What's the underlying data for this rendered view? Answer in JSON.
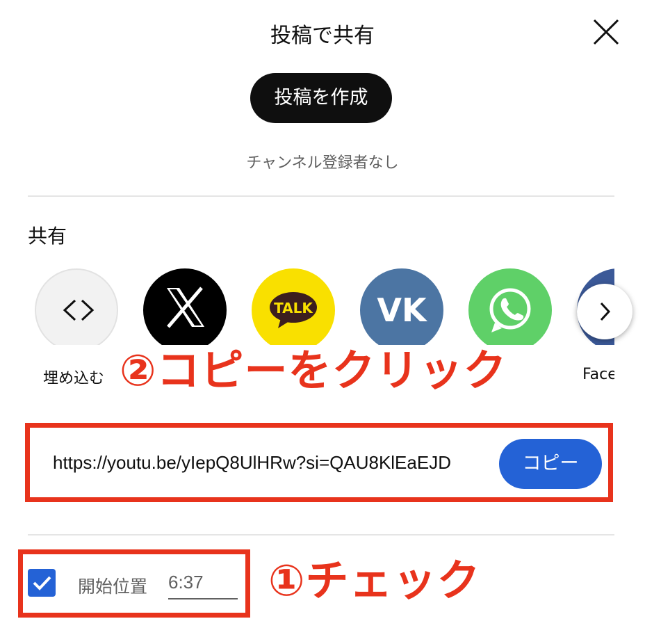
{
  "header": {
    "title": "投稿で共有",
    "close_icon": "close-icon"
  },
  "create_post": {
    "label": "投稿を作成"
  },
  "subscribers_text": "チャンネル登録者なし",
  "share": {
    "heading": "共有",
    "items": [
      {
        "label": "埋め込む",
        "icon": "embed-icon"
      },
      {
        "label": "",
        "icon": "x-logo-icon",
        "text": "X"
      },
      {
        "label": "",
        "icon": "kakaotalk-icon",
        "text": "TALK"
      },
      {
        "label": "",
        "icon": "vk-icon",
        "text": "VK"
      },
      {
        "label": "",
        "icon": "whatsapp-icon"
      },
      {
        "label": "Face",
        "icon": "facebook-icon"
      }
    ],
    "next_icon": "chevron-right-icon"
  },
  "link": {
    "url": "https://youtu.be/yIepQ8UlHRw?si=QAU8KlEaEJD",
    "copy_label": "コピー"
  },
  "start_position": {
    "checked": true,
    "label": "開始位置",
    "time": "6:37"
  },
  "annotations": {
    "step1": "①チェック",
    "step2": "②コピーをクリック"
  },
  "colors": {
    "annotation_red": "#e8331c",
    "copy_blue": "#2462d6",
    "x_black": "#000000",
    "kakao_yellow": "#f9e000",
    "vk_blue": "#4c75a3",
    "whatsapp_green": "#5fd068",
    "facebook_blue": "#3b5998"
  }
}
